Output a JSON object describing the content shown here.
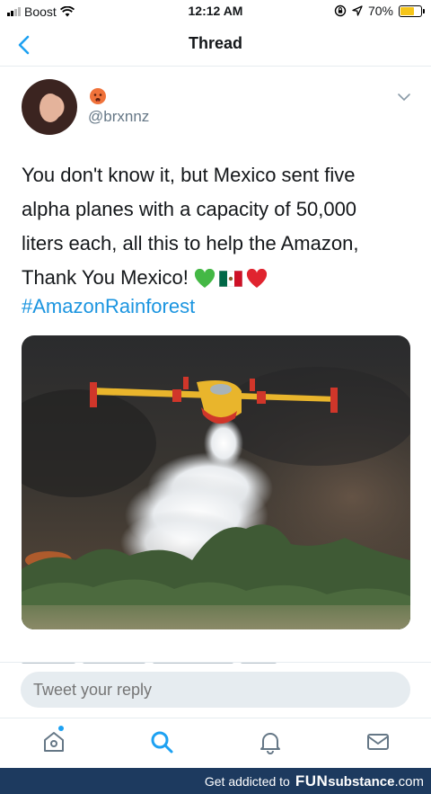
{
  "status_bar": {
    "carrier": "Boost",
    "time": "12:12 AM",
    "battery_percent": "70%",
    "battery_level": 0.7,
    "icons": [
      "signal-bars-icon",
      "wifi-icon",
      "rotation-lock-icon",
      "location-arrow-icon",
      "battery-icon"
    ]
  },
  "nav": {
    "title": "Thread",
    "back_icon": "chevron-left-icon"
  },
  "tweet": {
    "handle": "@brxnnz",
    "display_name_emoji": "hot-face-emoji",
    "text_lines": [
      "You don't know it, but Mexico sent five",
      "alpha planes with a capacity of 50,000",
      "liters each, all this to help the Amazon,",
      "Thank You Mexico!"
    ],
    "trailing_emojis": [
      "green-heart-emoji",
      "mexico-flag-emoji",
      "red-heart-emoji"
    ],
    "hashtag": "#AmazonRainforest"
  },
  "reply": {
    "placeholder": "Tweet your reply"
  },
  "tab_bar": {
    "tabs": [
      "home-icon",
      "search-icon",
      "notifications-icon",
      "messages-icon"
    ]
  },
  "banner": {
    "prefix": "Get addicted to",
    "brand_bold": "FUN",
    "brand_rest": "substance",
    "brand_suffix": ".com"
  },
  "colors": {
    "link_blue": "#1b95e0",
    "accent_blue": "#1da1f2",
    "text": "#14171a",
    "secondary_text": "#657786",
    "banner_bg": "#1d3a5f"
  }
}
